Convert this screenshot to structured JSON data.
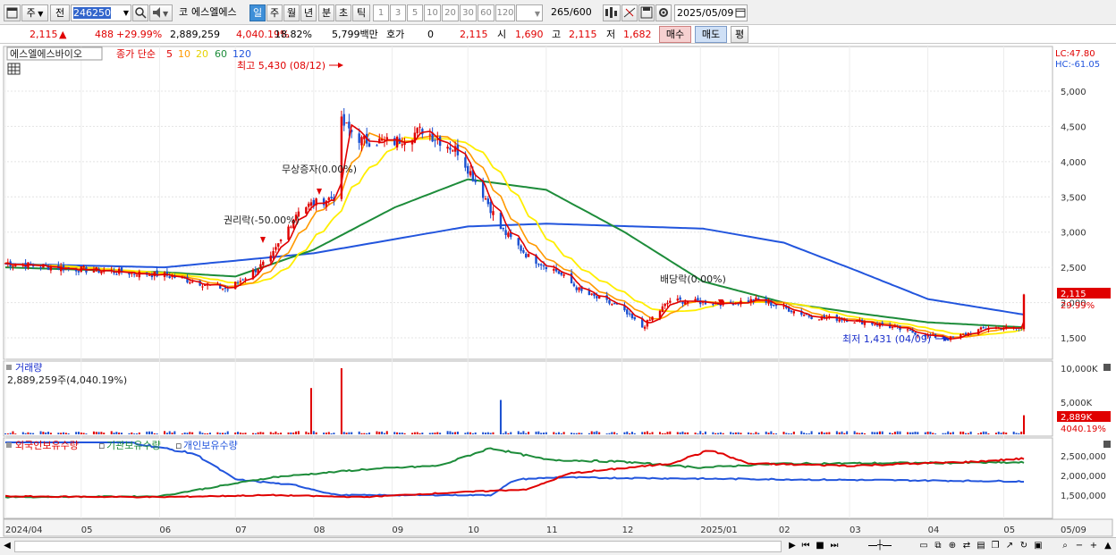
{
  "toolbar": {
    "market_type": "주",
    "prev_btn": "전",
    "stock_code": "246250",
    "stock_name": "에스엘에스",
    "market_tag": "코",
    "periods": [
      "일",
      "주",
      "월",
      "년",
      "분",
      "초",
      "틱"
    ],
    "intervals": [
      "1",
      "3",
      "5",
      "10",
      "20",
      "30",
      "60",
      "120"
    ],
    "bar_count": "265",
    "bar_total": "/600",
    "date": "2025/05/09",
    "icons": [
      "window-menu-icon",
      "search-icon",
      "sound-icon",
      "chart-mode-icon",
      "no-draw-icon",
      "save-icon",
      "settings-icon",
      "calendar-icon"
    ]
  },
  "quote": {
    "price": "2,115",
    "up_mark": "▲",
    "change": "488",
    "change_pct": "+29.99%",
    "volume": "2,889,259",
    "vol_ratio": "4,040.19%",
    "turnover": "18.82%",
    "amount": "5,799백만",
    "hoga_label": "호가",
    "hoga_value": "0",
    "hoga_price": "2,115",
    "open_label": "시",
    "open": "1,690",
    "high_label": "고",
    "high": "2,115",
    "low_label": "저",
    "low": "1,682",
    "buy_btn": "매수",
    "sell_btn": "매도",
    "eval_btn": "평"
  },
  "price_panel": {
    "name": "에스엘에스바이오",
    "legend_label": "종가 단순",
    "ma_legend": [
      {
        "label": "5",
        "color": "#e00000"
      },
      {
        "label": "10",
        "color": "#ff9900"
      },
      {
        "label": "20",
        "color": "#ffee00"
      },
      {
        "label": "60",
        "color": "#1d8c3a"
      },
      {
        "label": "120",
        "color": "#2255dd"
      }
    ],
    "lc": "LC:47.80",
    "hc": "HC:-61.05",
    "price_ticks": [
      "5,000",
      "4,500",
      "4,000",
      "3,500",
      "3,000",
      "2,500",
      "2,000",
      "1,500"
    ],
    "last_price": "2,115",
    "last_pct": "29.99%",
    "annotations": {
      "high": "최고 5,430 (08/12)",
      "low": "최저 1,431 (04/09)",
      "rights": "권리락(-50.00%)",
      "bonus": "무상증자(0.00%)",
      "dividend": "배당락(0.00%)"
    }
  },
  "volume_panel": {
    "title": "거래량",
    "value": "2,889,259주(4,040.19%)",
    "ticks": [
      "10,000K",
      "5,000K"
    ],
    "last": "2,889K",
    "last_pct": "4040.19%"
  },
  "holding_panel": {
    "titles": [
      "외국인보유수량",
      "기관보유수량",
      "개인보유수량"
    ],
    "ticks": [
      "2,500,000",
      "2,000,000",
      "1,500,000"
    ]
  },
  "x_axis": {
    "labels": [
      "2024/04",
      "05",
      "06",
      "07",
      "08",
      "09",
      "10",
      "11",
      "12",
      "2025/01",
      "02",
      "03",
      "04",
      "05",
      "05/09"
    ]
  },
  "chart_data": {
    "type": "line",
    "series": [
      {
        "name": "종가",
        "points": [
          [
            "2024/04/01",
            2560
          ],
          [
            "2024/05/01",
            2470
          ],
          [
            "2024/06/03",
            2390
          ],
          [
            "2024/06/28",
            2190
          ],
          [
            "2024/07/15",
            2620
          ],
          [
            "2024/07/26",
            3330
          ],
          [
            "2024/08/09",
            3500
          ],
          [
            "2024/08/12",
            4550
          ],
          [
            "2024/08/20",
            4300
          ],
          [
            "2024/09/02",
            4280
          ],
          [
            "2024/09/13",
            4450
          ],
          [
            "2024/09/27",
            4150
          ],
          [
            "2024/10/08",
            3480
          ],
          [
            "2024/10/14",
            3050
          ],
          [
            "2024/10/25",
            2650
          ],
          [
            "2024/11/05",
            2450
          ],
          [
            "2024/11/15",
            2150
          ],
          [
            "2024/11/29",
            1950
          ],
          [
            "2024/12/09",
            1650
          ],
          [
            "2024/12/20",
            2030
          ],
          [
            "2025/01/10",
            1990
          ],
          [
            "2025/01/24",
            2040
          ],
          [
            "2025/02/14",
            1800
          ],
          [
            "2025/02/28",
            1760
          ],
          [
            "2025/03/14",
            1680
          ],
          [
            "2025/03/28",
            1560
          ],
          [
            "2025/04/09",
            1480
          ],
          [
            "2025/04/25",
            1650
          ],
          [
            "2025/05/08",
            1627
          ],
          [
            "2025/05/09",
            2115
          ]
        ]
      },
      {
        "name": "60",
        "points": [
          [
            "2024/04/01",
            2500
          ],
          [
            "2024/06/03",
            2430
          ],
          [
            "2024/07/01",
            2370
          ],
          [
            "2024/08/01",
            2750
          ],
          [
            "2024/09/02",
            3350
          ],
          [
            "2024/10/01",
            3750
          ],
          [
            "2024/11/01",
            3600
          ],
          [
            "2024/12/02",
            3000
          ],
          [
            "2025/01/02",
            2300
          ],
          [
            "2025/02/03",
            2000
          ],
          [
            "2025/03/04",
            1850
          ],
          [
            "2025/04/01",
            1720
          ],
          [
            "2025/05/09",
            1650
          ]
        ]
      },
      {
        "name": "120",
        "points": [
          [
            "2024/04/01",
            2550
          ],
          [
            "2024/06/03",
            2500
          ],
          [
            "2024/08/01",
            2700
          ],
          [
            "2024/09/02",
            2900
          ],
          [
            "2024/10/01",
            3080
          ],
          [
            "2024/11/01",
            3120
          ],
          [
            "2025/01/02",
            3050
          ],
          [
            "2025/02/03",
            2850
          ],
          [
            "2025/03/04",
            2450
          ],
          [
            "2025/04/01",
            2050
          ],
          [
            "2025/05/09",
            1830
          ]
        ]
      }
    ],
    "ylim": [
      1300,
      5600
    ],
    "volume_spikes": [
      {
        "date": "2024/08/12",
        "volume_k": 10000
      },
      {
        "date": "2024/07/31",
        "volume_k": 7000
      },
      {
        "date": "2024/10/14",
        "volume_k": 5200
      },
      {
        "date": "2025/05/09",
        "volume_k": 2889
      }
    ]
  }
}
